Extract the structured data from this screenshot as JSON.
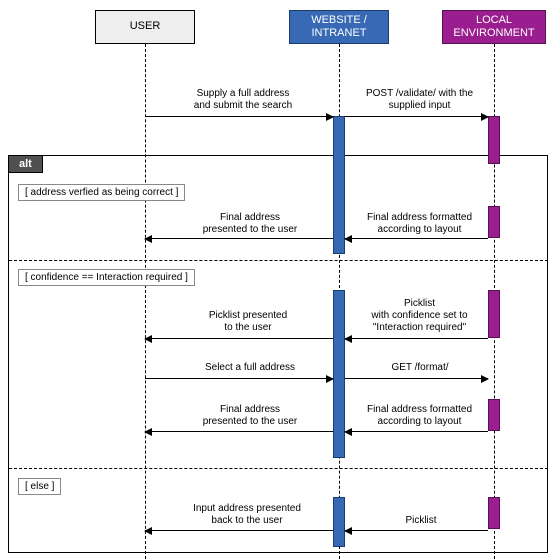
{
  "participants": {
    "user": "USER",
    "website": "WEBSITE /\nINTRANET",
    "local": "LOCAL\nENVIRONMENT"
  },
  "alt": {
    "tag": "alt",
    "guard1": "[ address verfied as being correct ]",
    "guard2": "[ confidence == Interaction required ]",
    "guard3": "[ else ]"
  },
  "msg": {
    "m1a": "Supply a full address\nand submit the search",
    "m1b": "POST /validate/ with the\nsupplied input",
    "m2a": "Final address\npresented to the user",
    "m2b": "Final address formatted\naccording to layout",
    "m3a": "Picklist presented\nto the user",
    "m3b": "Picklist\nwith confidence set to\n\"Interaction required\"",
    "m4a": "Select a full address",
    "m4b": "GET /format/",
    "m5a": "Final address\npresented to the user",
    "m5b": "Final address formatted\naccording to layout",
    "m6a": "Input address presented\nback to the user",
    "m6b": "Picklist"
  }
}
